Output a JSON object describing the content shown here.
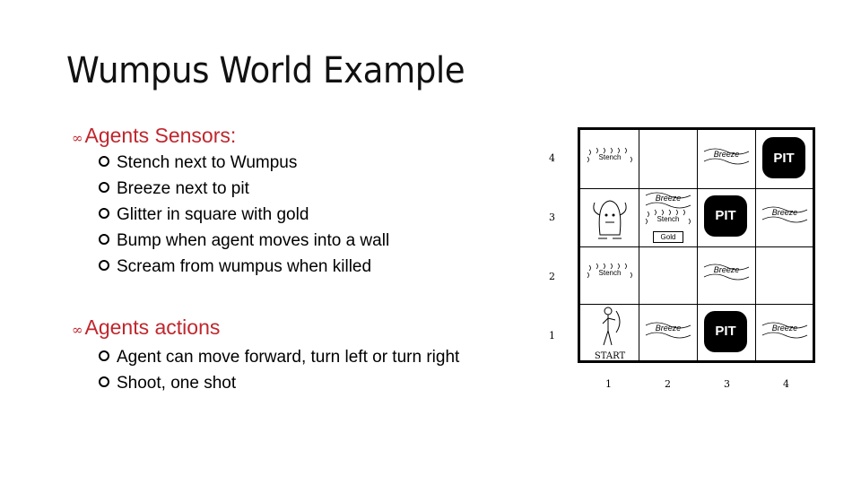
{
  "slide": {
    "title": "Wumpus World Example",
    "accent_color": "#c0262d",
    "sections": [
      {
        "heading": "Agents Sensors:",
        "items": [
          "Stench next to Wumpus",
          "Breeze next to pit",
          "Glitter in square with gold",
          "Bump when agent moves into a wall",
          "Scream from wumpus when killed"
        ]
      },
      {
        "heading": "Agents actions",
        "items": [
          "Agent can move forward, turn left or turn right",
          "Shoot, one shot"
        ]
      }
    ],
    "bullet_glyph": "∞"
  },
  "grid": {
    "row_labels": [
      "4",
      "3",
      "2",
      "1"
    ],
    "col_labels": [
      "1",
      "2",
      "3",
      "4"
    ],
    "labels": {
      "pit": "PIT",
      "breeze": "Breeze",
      "stench": "Stench",
      "gold": "Gold",
      "start": "START"
    },
    "cells": [
      [
        {
          "contents": [
            "stench"
          ]
        },
        {
          "contents": []
        },
        {
          "contents": [
            "breeze"
          ]
        },
        {
          "contents": [
            "pit"
          ]
        }
      ],
      [
        {
          "contents": [
            "wumpus"
          ]
        },
        {
          "contents": [
            "breeze",
            "stench",
            "gold"
          ]
        },
        {
          "contents": [
            "pit"
          ]
        },
        {
          "contents": [
            "breeze"
          ]
        }
      ],
      [
        {
          "contents": [
            "stench"
          ]
        },
        {
          "contents": []
        },
        {
          "contents": [
            "breeze"
          ]
        },
        {
          "contents": []
        }
      ],
      [
        {
          "contents": [
            "agent",
            "start"
          ]
        },
        {
          "contents": [
            "breeze"
          ]
        },
        {
          "contents": [
            "pit"
          ]
        },
        {
          "contents": [
            "breeze"
          ]
        }
      ]
    ]
  }
}
